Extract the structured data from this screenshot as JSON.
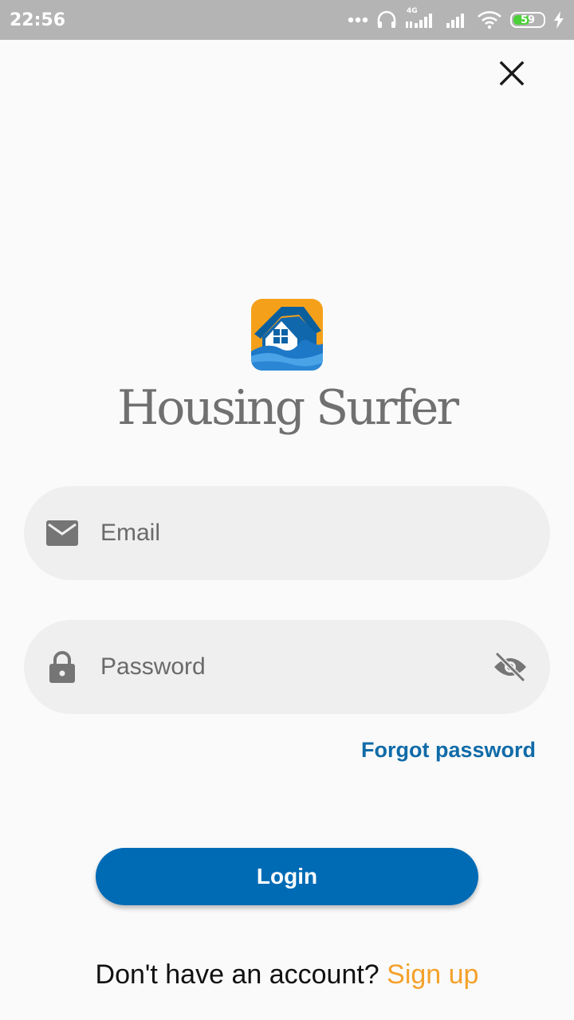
{
  "status_bar": {
    "time": "22:56",
    "network_label": "4G",
    "battery_level": "59",
    "battery_fill_fraction": 0.59
  },
  "header": {
    "close_icon": "close-icon"
  },
  "brand": {
    "logo_icon": "house-wave-icon",
    "name": "Housing Surfer"
  },
  "form": {
    "email": {
      "icon": "email-icon",
      "placeholder": "Email",
      "value": ""
    },
    "password": {
      "icon": "lock-icon",
      "placeholder": "Password",
      "value": "",
      "visibility_icon": "eye-off-icon"
    },
    "forgot_label": "Forgot password",
    "login_label": "Login"
  },
  "footer": {
    "prompt": "Don't have an account?",
    "signup_label": "Sign up"
  },
  "colors": {
    "primary": "#006bb5",
    "link": "#106ba8",
    "accent": "#f4a12a",
    "field_bg": "#efefef",
    "status_bar_bg": "#b4b4b4"
  }
}
